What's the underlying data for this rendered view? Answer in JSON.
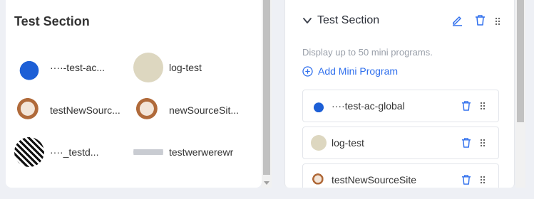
{
  "preview": {
    "title": "Test Section",
    "items": [
      {
        "name": "····-test-ac...",
        "thumb": "blue"
      },
      {
        "name": "log-test",
        "thumb": "beige"
      },
      {
        "name": "testNewSourc...",
        "thumb": "cat"
      },
      {
        "name": "newSourceSit...",
        "thumb": "cat"
      },
      {
        "name": "····_testd...",
        "thumb": "qr"
      },
      {
        "name": "testwerwerewr",
        "thumb": "gray"
      }
    ]
  },
  "config": {
    "title": "Test Section",
    "hint": "Display up to 50 mini programs.",
    "add_label": "Add Mini Program",
    "rows": [
      {
        "name": "····test-ac-global",
        "thumb": "blue"
      },
      {
        "name": "log-test",
        "thumb": "beige"
      },
      {
        "name": "testNewSourceSite",
        "thumb": "cat"
      }
    ]
  },
  "colors": {
    "accent": "#2f6fed",
    "muted": "#9aa0aa",
    "border": "#e3e6eb"
  },
  "icons": [
    "chevron-down-icon",
    "edit-icon",
    "trash-icon",
    "drag-handle-icon",
    "plus-circle-icon"
  ]
}
